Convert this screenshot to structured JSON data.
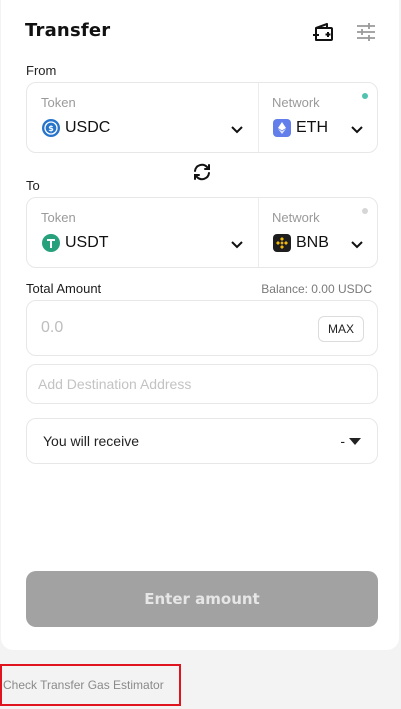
{
  "header": {
    "title": "Transfer",
    "icons": [
      "wallet-add-icon",
      "settings-sliders-icon"
    ]
  },
  "from": {
    "label": "From",
    "token_label": "Token",
    "token": "USDC",
    "token_icon": "usdc-icon",
    "token_color": "#2775ca",
    "network_label": "Network",
    "network": "ETH",
    "network_icon": "ethereum-icon",
    "network_color": "#627eea",
    "status_dot_color": "#4fc3b0"
  },
  "swap_icon": "swap-arrows-icon",
  "to": {
    "label": "To",
    "token_label": "Token",
    "token": "USDT",
    "token_icon": "usdt-icon",
    "token_color": "#26a17b",
    "network_label": "Network",
    "network": "BNB",
    "network_icon": "bnb-icon",
    "network_color": "#f0b90b",
    "status_dot_color": "#d6d6d6"
  },
  "amount": {
    "label": "Total Amount",
    "balance": "Balance: 0.00 USDC",
    "placeholder": "0.0",
    "max_label": "MAX"
  },
  "destination": {
    "placeholder": "Add Destination Address"
  },
  "receive": {
    "label": "You will receive",
    "value": "-"
  },
  "submit_label": "Enter amount",
  "gas_estimator_link": "Check Transfer Gas Estimator"
}
